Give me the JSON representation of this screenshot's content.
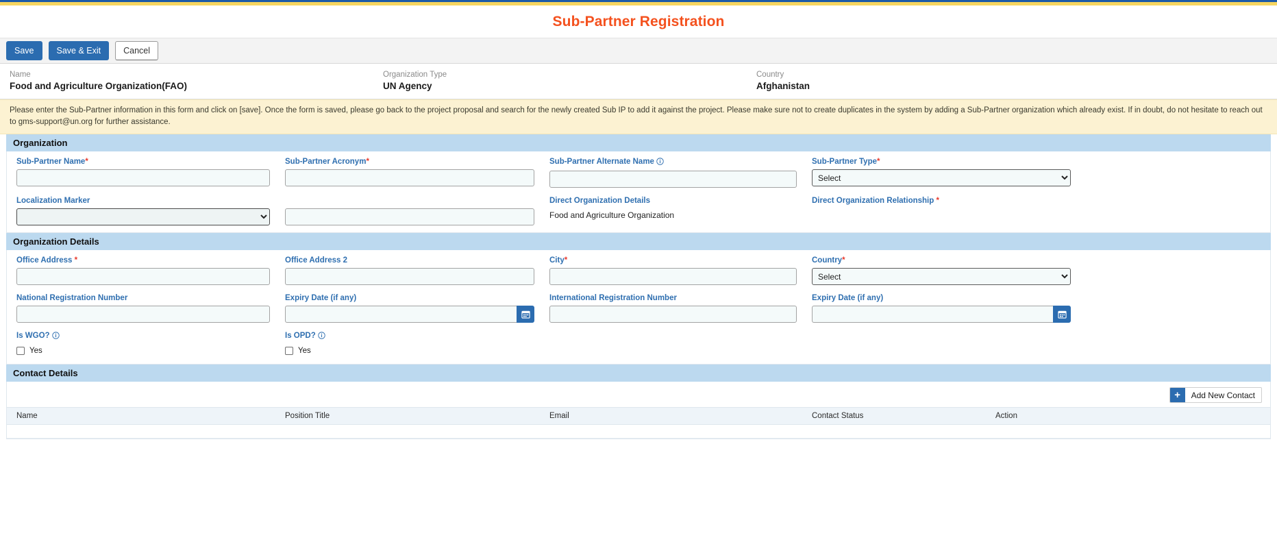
{
  "theme": {
    "accent_blue": "#1c5aa8",
    "accent_yellow": "#f6d560",
    "title_orange": "#f4511e",
    "label_blue": "#2f6fb0",
    "section_band": "#bcd9ef",
    "alert_bg": "#fcf2d2",
    "required_red": "#e8392c"
  },
  "header": {
    "title": "Sub-Partner Registration"
  },
  "toolbar": {
    "save_label": "Save",
    "save_exit_label": "Save & Exit",
    "cancel_label": "Cancel"
  },
  "summary": {
    "name_label": "Name",
    "name_value": "Food and Agriculture Organization(FAO)",
    "org_type_label": "Organization Type",
    "org_type_value": "UN Agency",
    "country_label": "Country",
    "country_value": "Afghanistan"
  },
  "alert": {
    "text": "Please enter the Sub-Partner information in this form and click on [save]. Once the form is saved, please go back to the project proposal and search for the newly created Sub IP to add it against the project. Please make sure not to create duplicates in the system by adding a Sub-Partner organization which already exist. If in doubt, do not hesitate to reach out to gms-support@un.org for further assistance."
  },
  "organization": {
    "section_title": "Organization",
    "sub_partner_name": {
      "label": "Sub-Partner Name",
      "required": "*",
      "value": "",
      "placeholder": ""
    },
    "sub_partner_acronym": {
      "label": "Sub-Partner Acronym",
      "required": "*",
      "value": "",
      "placeholder": ""
    },
    "sub_partner_alternate_name": {
      "label": "Sub-Partner Alternate Name",
      "info_icon": "info-icon",
      "value": "",
      "placeholder": ""
    },
    "sub_partner_type": {
      "label": "Sub-Partner Type",
      "required": "*",
      "selected": "Select",
      "options": [
        "Select"
      ]
    },
    "localization_marker": {
      "label": "Localization Marker",
      "selected": "",
      "options": [
        ""
      ]
    },
    "localization_marker_detail": {
      "value": "",
      "placeholder": ""
    },
    "direct_organization_details": {
      "label": "Direct Organization Details",
      "value": "Food and Agriculture Organization"
    },
    "direct_organization_relationship": {
      "label": "Direct Organization Relationship",
      "required": "*",
      "value": ""
    }
  },
  "organization_details": {
    "section_title": "Organization Details",
    "office_address": {
      "label": "Office Address",
      "required": "*",
      "value": "",
      "placeholder": ""
    },
    "office_address_2": {
      "label": "Office Address 2",
      "value": "",
      "placeholder": ""
    },
    "city": {
      "label": "City",
      "required": "*",
      "value": "",
      "placeholder": ""
    },
    "country": {
      "label": "Country",
      "required": "*",
      "selected": "Select",
      "options": [
        "Select"
      ]
    },
    "national_registration_number": {
      "label": "National Registration Number",
      "value": "",
      "placeholder": ""
    },
    "national_expiry_date": {
      "label": "Expiry Date (if any)",
      "value": "",
      "placeholder": "",
      "icon": "calendar-icon"
    },
    "international_registration_number": {
      "label": "International Registration Number",
      "value": "",
      "placeholder": ""
    },
    "international_expiry_date": {
      "label": "Expiry Date (if any)",
      "value": "",
      "placeholder": "",
      "icon": "calendar-icon"
    },
    "is_wgo": {
      "label": "Is WGO?",
      "info_icon": "info-icon",
      "checkbox_label": "Yes",
      "checked": false
    },
    "is_opd": {
      "label": "Is OPD?",
      "info_icon": "info-icon",
      "checkbox_label": "Yes",
      "checked": false
    }
  },
  "contact_details": {
    "section_title": "Contact Details",
    "add_button_label": "Add New Contact",
    "add_button_icon": "plus-icon",
    "columns": [
      "Name",
      "Position Title",
      "Email",
      "Contact Status",
      "Action"
    ],
    "rows": []
  }
}
